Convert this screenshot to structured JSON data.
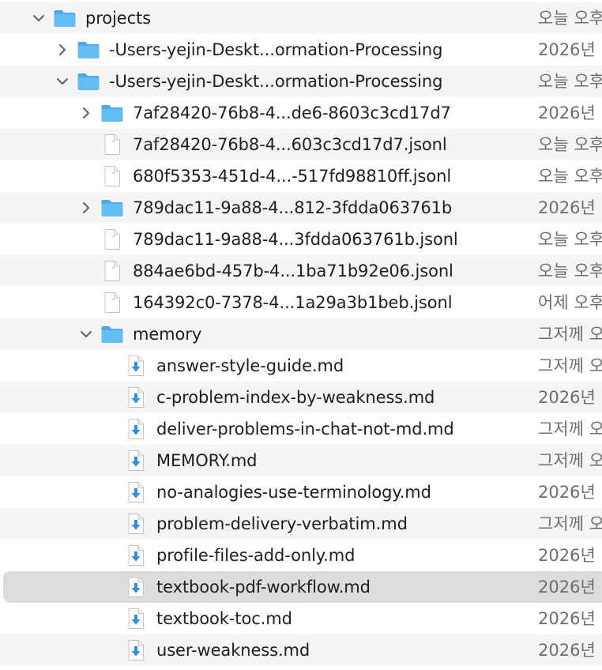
{
  "rows": [
    {
      "name": "projects",
      "date": "오늘 오후",
      "type": "folder",
      "expanded": true,
      "depth": 0
    },
    {
      "name": "-Users-yejin-Deskt...ormation-Processing",
      "date": "2026년",
      "type": "folder",
      "expanded": false,
      "depth": 1
    },
    {
      "name": "-Users-yejin-Deskt...ormation-Processing",
      "date": "오늘 오후",
      "type": "folder",
      "expanded": true,
      "depth": 1
    },
    {
      "name": "7af28420-76b8-4...de6-8603c3cd17d7",
      "date": "2026년",
      "type": "folder",
      "expanded": false,
      "depth": 2
    },
    {
      "name": "7af28420-76b8-4...603c3cd17d7.jsonl",
      "date": "오늘 오후",
      "type": "file",
      "depth": 2
    },
    {
      "name": "680f5353-451d-4...-517fd98810ff.jsonl",
      "date": "오늘 오후",
      "type": "file",
      "depth": 2
    },
    {
      "name": "789dac11-9a88-4...812-3fdda063761b",
      "date": "2026년",
      "type": "folder",
      "expanded": false,
      "depth": 2
    },
    {
      "name": "789dac11-9a88-4...3fdda063761b.jsonl",
      "date": "오늘 오후",
      "type": "file",
      "depth": 2
    },
    {
      "name": "884ae6bd-457b-4...1ba71b92e06.jsonl",
      "date": "오늘 오후",
      "type": "file",
      "depth": 2
    },
    {
      "name": "164392c0-7378-4...1a29a3b1beb.jsonl",
      "date": "어제 오후",
      "type": "file",
      "depth": 2
    },
    {
      "name": "memory",
      "date": "그저께 오",
      "type": "folder",
      "expanded": true,
      "depth": 2
    },
    {
      "name": "answer-style-guide.md",
      "date": "그저께 오",
      "type": "md",
      "depth": 3
    },
    {
      "name": "c-problem-index-by-weakness.md",
      "date": "2026년",
      "type": "md",
      "depth": 3
    },
    {
      "name": "deliver-problems-in-chat-not-md.md",
      "date": "그저께 오",
      "type": "md",
      "depth": 3
    },
    {
      "name": "MEMORY.md",
      "date": "그저께 오",
      "type": "md",
      "depth": 3
    },
    {
      "name": "no-analogies-use-terminology.md",
      "date": "2026년",
      "type": "md",
      "depth": 3
    },
    {
      "name": "problem-delivery-verbatim.md",
      "date": "그저께 오",
      "type": "md",
      "depth": 3
    },
    {
      "name": "profile-files-add-only.md",
      "date": "2026년",
      "type": "md",
      "depth": 3
    },
    {
      "name": "textbook-pdf-workflow.md",
      "date": "2026년",
      "type": "md",
      "depth": 3,
      "selected": true
    },
    {
      "name": "textbook-toc.md",
      "date": "2026년",
      "type": "md",
      "depth": 3
    },
    {
      "name": "user-weakness.md",
      "date": "2026년",
      "type": "md",
      "depth": 3
    }
  ],
  "colors": {
    "folder_front": "#62bdf3",
    "folder_back": "#4aa9e8",
    "md_arrow": "#2e8fe0",
    "stripe": "#f5f5f5",
    "selection": "#dcdcdc",
    "text": "#1e1e1e",
    "date_text": "#6e6e6e"
  }
}
